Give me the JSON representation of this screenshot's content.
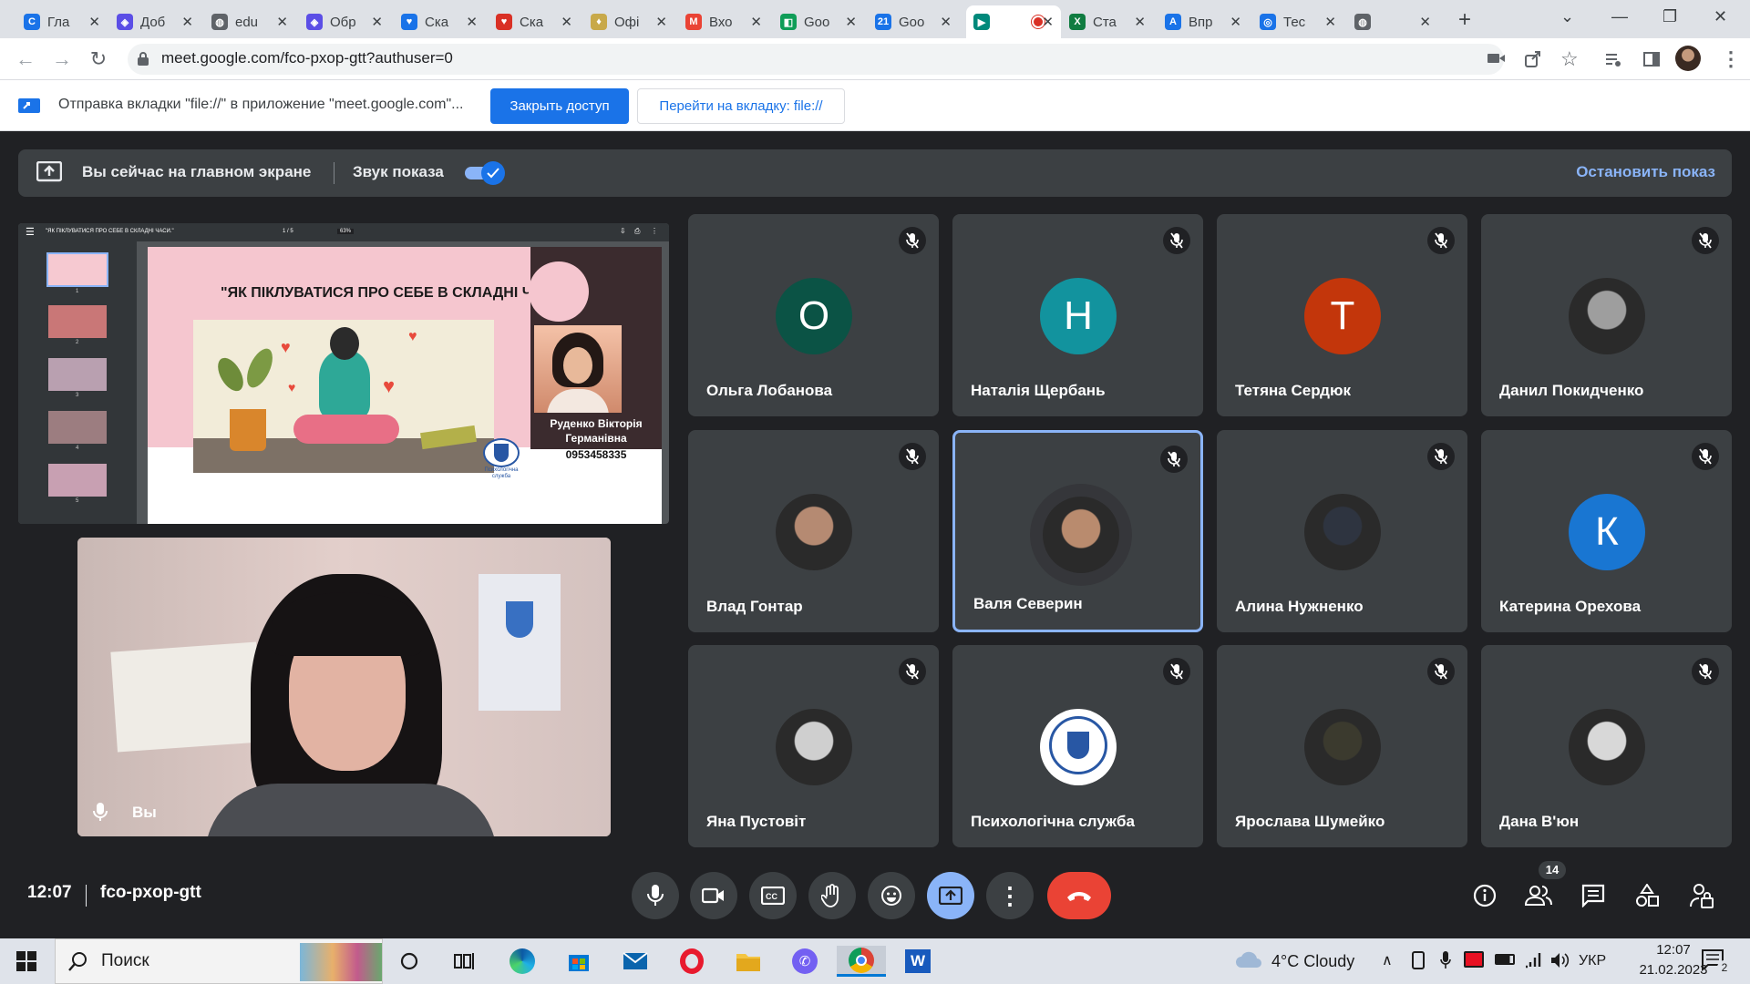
{
  "browser": {
    "tabs": [
      {
        "title": "Гла",
        "color": "#1a73e8",
        "glyph": "C"
      },
      {
        "title": "Доб",
        "color": "#5b4ee6",
        "glyph": "◈"
      },
      {
        "title": "edu",
        "color": "#5f6368",
        "glyph": "◍"
      },
      {
        "title": "Обр",
        "color": "#5b4ee6",
        "glyph": "◈"
      },
      {
        "title": "Ска",
        "color": "#1a73e8",
        "glyph": "♥"
      },
      {
        "title": "Ска",
        "color": "#d93025",
        "glyph": "♥"
      },
      {
        "title": "Офі",
        "color": "#c8a94a",
        "glyph": "♦"
      },
      {
        "title": "Вхо",
        "color": "#ea4335",
        "glyph": "M"
      },
      {
        "title": "Goo",
        "color": "#0f9d58",
        "glyph": "◧"
      },
      {
        "title": "Goo",
        "color": "#1a73e8",
        "glyph": "21"
      },
      {
        "title": "",
        "color": "#00897b",
        "glyph": "▶",
        "active": true
      },
      {
        "title": "Ста",
        "color": "#107c41",
        "glyph": "X"
      },
      {
        "title": "Впр",
        "color": "#1a73e8",
        "glyph": "A"
      },
      {
        "title": "Тес",
        "color": "#1a73e8",
        "glyph": "◎"
      },
      {
        "title": "",
        "color": "#5f6368",
        "glyph": "◍"
      }
    ],
    "url": "meet.google.com/fco-pxop-gtt?authuser=0"
  },
  "infobar": {
    "message": "Отправка вкладки \"file://\" в приложение \"meet.google.com\"...",
    "stop_access_label": "Закрыть доступ",
    "switch_tab_label": "Перейти на вкладку: file://"
  },
  "sharebar": {
    "main_screen_text": "Вы сейчас на главном экране",
    "sound_label": "Звук показа",
    "stop_label": "Остановить показ"
  },
  "presentation": {
    "title_small": "\"ЯК ПІКЛУВАТИСЯ ПРО СЕБЕ В СКЛАДНІ ЧАСИ.\"",
    "page": "1 / 5",
    "zoom": "63%",
    "slide_title": "\"ЯК ПІКЛУВАТИСЯ ПРО СЕБЕ В СКЛАДНІ ЧАСИ.\"",
    "author_name": "Руденко Вікторія Германівна",
    "phone": "0953458335",
    "logo_text": "Психологічна служба",
    "thumb_pages": [
      "1",
      "2",
      "3",
      "4",
      "5"
    ]
  },
  "self_view": {
    "label": "Вы"
  },
  "participants": [
    {
      "name": "Ольга Лобанова",
      "initial": "О",
      "color": "#0b5345",
      "type": "letter"
    },
    {
      "name": "Наталія Щербань",
      "initial": "Н",
      "color": "#12939e",
      "type": "letter"
    },
    {
      "name": "Тетяна Сердюк",
      "initial": "Т",
      "color": "#c3360b",
      "type": "letter"
    },
    {
      "name": "Данил Покидченко",
      "initial": "",
      "color": "#9e9e9e",
      "type": "photo"
    },
    {
      "name": "Влад Гонтар",
      "initial": "",
      "color": "#b58a72",
      "type": "photo"
    },
    {
      "name": "Валя Северин",
      "initial": "",
      "color": "#b98b6e",
      "type": "photo",
      "speaking": true
    },
    {
      "name": "Алина Нужненко",
      "initial": "",
      "color": "#2e3440",
      "type": "photo"
    },
    {
      "name": "Катерина Орехова",
      "initial": "К",
      "color": "#1976d2",
      "type": "letter"
    },
    {
      "name": "Яна Пустовіт",
      "initial": "",
      "color": "#cfcfcf",
      "type": "photo"
    },
    {
      "name": "Психологічна служба",
      "initial": "",
      "color": "#ffffff",
      "type": "logo"
    },
    {
      "name": "Ярослава Шумейко",
      "initial": "",
      "color": "#3b3a2e",
      "type": "photo"
    },
    {
      "name": "Дана В'юн",
      "initial": "",
      "color": "#d8d8d8",
      "type": "photo"
    }
  ],
  "controls": {
    "time": "12:07",
    "meeting_code": "fco-pxop-gtt",
    "participants_count": "14"
  },
  "taskbar": {
    "search_label": "Поиск",
    "weather": "4°C Cloudy",
    "lang": "УКР",
    "time": "12:07",
    "date": "21.02.2023",
    "notifications": "2"
  }
}
